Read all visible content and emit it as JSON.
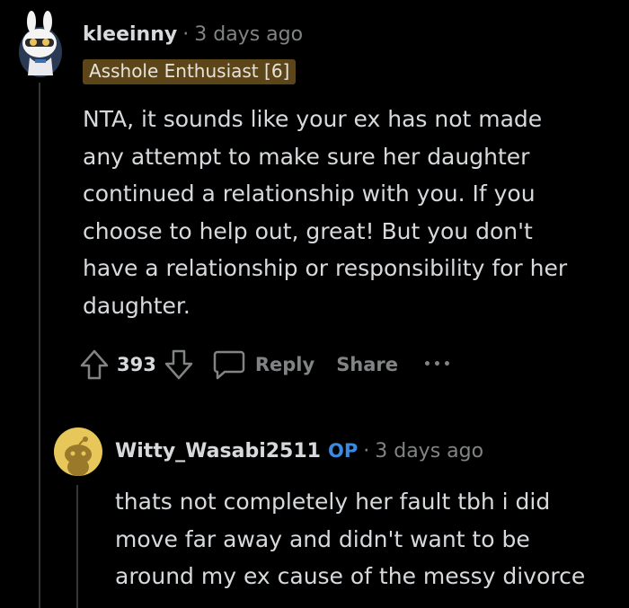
{
  "comment": {
    "username": "kleeinny",
    "separator": "·",
    "time": "3 days ago",
    "flair": "Asshole Enthusiast [6]",
    "body": "NTA, it sounds like your ex has not made\nany attempt to make sure her daughter\ncontinued a relationship with you. If you\nchoose to help out, great! But you don't\nhave a relationship or responsibility for her\ndaughter.",
    "score": "393",
    "reply_label": "Reply",
    "share_label": "Share",
    "more_label": "•••"
  },
  "reply": {
    "username": "Witty_Wasabi2511",
    "op_badge": "OP",
    "separator": "·",
    "time": "3 days ago",
    "body": "thats not completely her fault tbh i did\nmove far away and didn't want to be\naround my ex cause of the messy divorce"
  },
  "colors": {
    "background": "#000000",
    "text": "#d7dadc",
    "muted": "#818384",
    "op": "#3b8ae0",
    "flair_bg": "#5c4519",
    "thread_line": "#343536"
  }
}
